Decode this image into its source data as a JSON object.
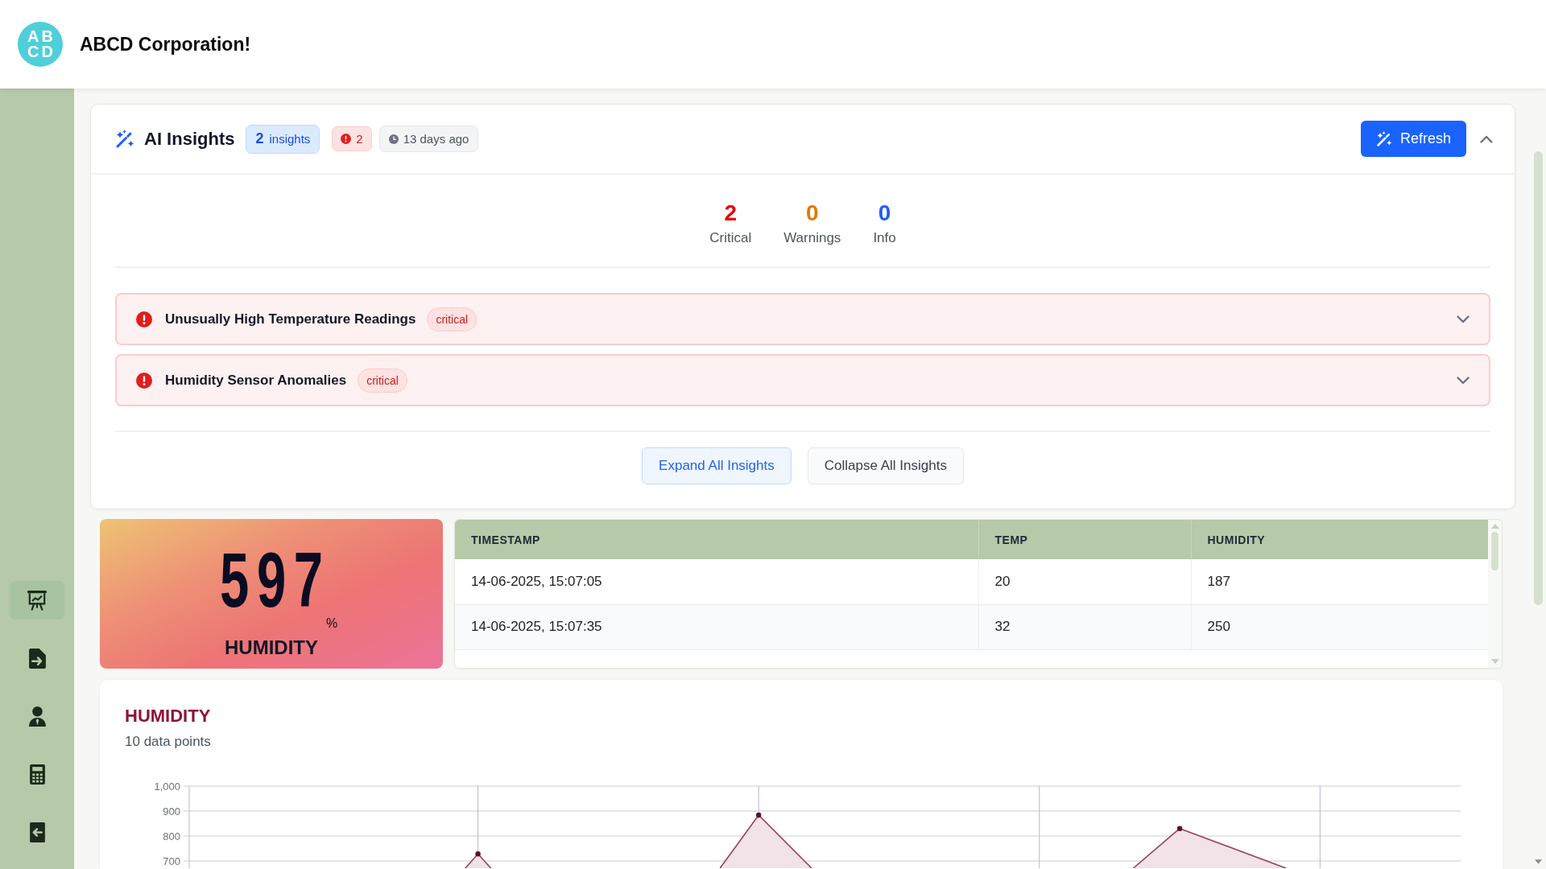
{
  "header": {
    "logo_lines": [
      "AB",
      "CD"
    ],
    "title": "ABCD Corporation!"
  },
  "sidebar": {
    "items": [
      {
        "selected": true
      },
      {
        "selected": false
      },
      {
        "selected": false
      },
      {
        "selected": false
      },
      {
        "selected": false
      }
    ]
  },
  "insights_panel": {
    "title": "AI Insights",
    "count_badge": "**2** insights",
    "alert_count": "2",
    "updated": "13 days ago",
    "refresh_button": "Refresh",
    "expanded": true,
    "summary": [
      {
        "kind": "critical",
        "count": "2",
        "label": "Critical"
      },
      {
        "kind": "warning",
        "count": "0",
        "label": "Warnings"
      },
      {
        "kind": "info",
        "count": "0",
        "label": "Info"
      }
    ],
    "insights": [
      {
        "kind": "critical",
        "title": "Unusually High Temperature Readings",
        "severity": "critical",
        "expanded": false
      },
      {
        "kind": "critical",
        "title": "Humidity Sensor Anomalies",
        "severity": "critical",
        "expanded": false
      }
    ],
    "actions": [
      {
        "kind": "primary",
        "label": "Expand All Insights"
      },
      {
        "kind": "secondary",
        "label": "Collapse All Insights"
      }
    ]
  },
  "humidity_card": {
    "value": "597",
    "unit": "%",
    "label": "HUMIDITY"
  },
  "table": {
    "columns": [
      "TIMESTAMP",
      "TEMP",
      "HUMIDITY"
    ],
    "rows": [
      [
        "14-06-2025, 15:07:05",
        "20",
        "187"
      ],
      [
        "14-06-2025, 15:07:35",
        "32",
        "250"
      ]
    ]
  },
  "chart": {
    "title": "HUMIDITY",
    "subtitle": "10 data points",
    "y_axis_labels": [
      "1,000",
      "900",
      "800",
      "700"
    ]
  }
}
